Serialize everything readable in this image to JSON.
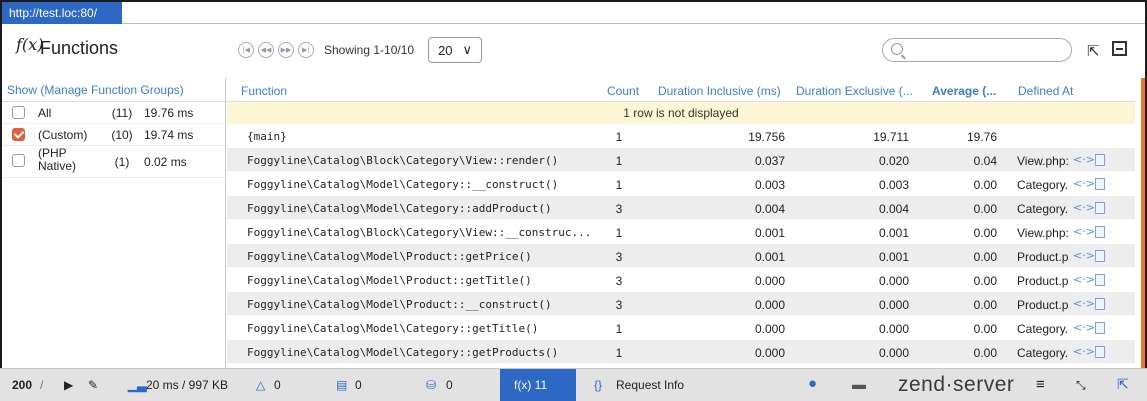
{
  "browser": {
    "url": "http://test.loc:80/"
  },
  "header": {
    "fx_symbol": "f(x)",
    "title": "Functions",
    "showing": "Showing 1-10/10",
    "per_page": "20",
    "per_page_chevron": "∨"
  },
  "icons": {
    "pager": [
      "first-page-icon",
      "prev-page-icon",
      "next-page-icon",
      "last-page-icon"
    ],
    "search": "search-icon",
    "export": "export-icon",
    "collapse": "collapse-icon"
  },
  "groups": {
    "header": "Show (Manage Function Groups)",
    "rows": [
      {
        "name": "All",
        "count": "(11)",
        "time": "19.76 ms",
        "checked": false
      },
      {
        "name": "(Custom)",
        "count": "(10)",
        "time": "19.74 ms",
        "checked": true
      },
      {
        "name": "(PHP Native)",
        "count": "(1)",
        "time": "0.02 ms",
        "checked": false
      }
    ]
  },
  "table": {
    "headers": {
      "function": "Function",
      "count": "Count",
      "inclusive": "Duration Inclusive (ms)",
      "exclusive": "Duration Exclusive (...",
      "average": "Average (...",
      "defined_at": "Defined At"
    },
    "notice": "1 row is not displayed",
    "code_glyph": "<·>",
    "rows": [
      {
        "function": "{main}",
        "count": "1",
        "inclusive": "19.756",
        "exclusive": "19.711",
        "average": "19.76",
        "defined_at": ""
      },
      {
        "function": "Foggyline\\Catalog\\Block\\Category\\View::render()",
        "count": "1",
        "inclusive": "0.037",
        "exclusive": "0.020",
        "average": "0.04",
        "defined_at": "View.php:..."
      },
      {
        "function": "Foggyline\\Catalog\\Model\\Category::__construct()",
        "count": "1",
        "inclusive": "0.003",
        "exclusive": "0.003",
        "average": "0.00",
        "defined_at": "Category..."
      },
      {
        "function": "Foggyline\\Catalog\\Model\\Category::addProduct()",
        "count": "3",
        "inclusive": "0.004",
        "exclusive": "0.004",
        "average": "0.00",
        "defined_at": "Category..."
      },
      {
        "function": "Foggyline\\Catalog\\Block\\Category\\View::__construc...",
        "count": "1",
        "inclusive": "0.001",
        "exclusive": "0.001",
        "average": "0.00",
        "defined_at": "View.php:..."
      },
      {
        "function": "Foggyline\\Catalog\\Model\\Product::getPrice()",
        "count": "3",
        "inclusive": "0.001",
        "exclusive": "0.001",
        "average": "0.00",
        "defined_at": "Product.p..."
      },
      {
        "function": "Foggyline\\Catalog\\Model\\Product::getTitle()",
        "count": "3",
        "inclusive": "0.000",
        "exclusive": "0.000",
        "average": "0.00",
        "defined_at": "Product.p..."
      },
      {
        "function": "Foggyline\\Catalog\\Model\\Product::__construct()",
        "count": "3",
        "inclusive": "0.000",
        "exclusive": "0.000",
        "average": "0.00",
        "defined_at": "Product.p..."
      },
      {
        "function": "Foggyline\\Catalog\\Model\\Category::getTitle()",
        "count": "1",
        "inclusive": "0.000",
        "exclusive": "0.000",
        "average": "0.00",
        "defined_at": "Category..."
      },
      {
        "function": "Foggyline\\Catalog\\Model\\Category::getProducts()",
        "count": "1",
        "inclusive": "0.000",
        "exclusive": "0.000",
        "average": "0.00",
        "defined_at": "Category..."
      }
    ]
  },
  "statusbar": {
    "status_code": "200",
    "separator": "/",
    "memory": "20 ms / 997 KB",
    "warnings": "0",
    "logs": "0",
    "db": "0",
    "functions_tab": "f(x) 11",
    "request_info": "Request Info",
    "brand": "zend·server",
    "accent_color": "#2c68c4"
  }
}
